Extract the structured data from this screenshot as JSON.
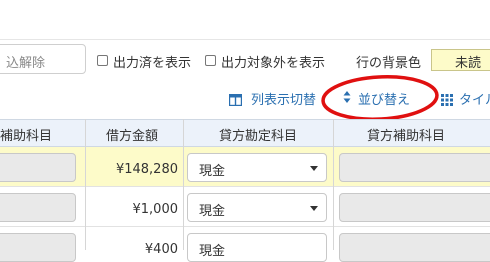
{
  "filters": {
    "search_value": "込解除",
    "show_exported_label": "出力済を表示",
    "show_excluded_label": "出力対象外を表示",
    "row_bg_label": "行の背景色",
    "row_bg_value": "未読"
  },
  "toolbar": {
    "column_toggle_label": "列表示切替",
    "sort_label": "並び替え",
    "tile_label": "タイル"
  },
  "table": {
    "headers": {
      "debit_sub": "補助科目",
      "debit_amount": "借方金額",
      "credit_account": "貸方勘定科目",
      "credit_sub": "貸方補助科目"
    },
    "rows": [
      {
        "amount": "¥148,280",
        "credit_account": "現金"
      },
      {
        "amount": "¥1,000",
        "credit_account": "現金"
      },
      {
        "amount": "¥400",
        "credit_account": "現金"
      }
    ]
  },
  "colors": {
    "highlight_row": "#fdfbc9",
    "header_bg": "#ecf2fa",
    "link": "#2a6fb0",
    "annotation_red": "#e01010"
  }
}
